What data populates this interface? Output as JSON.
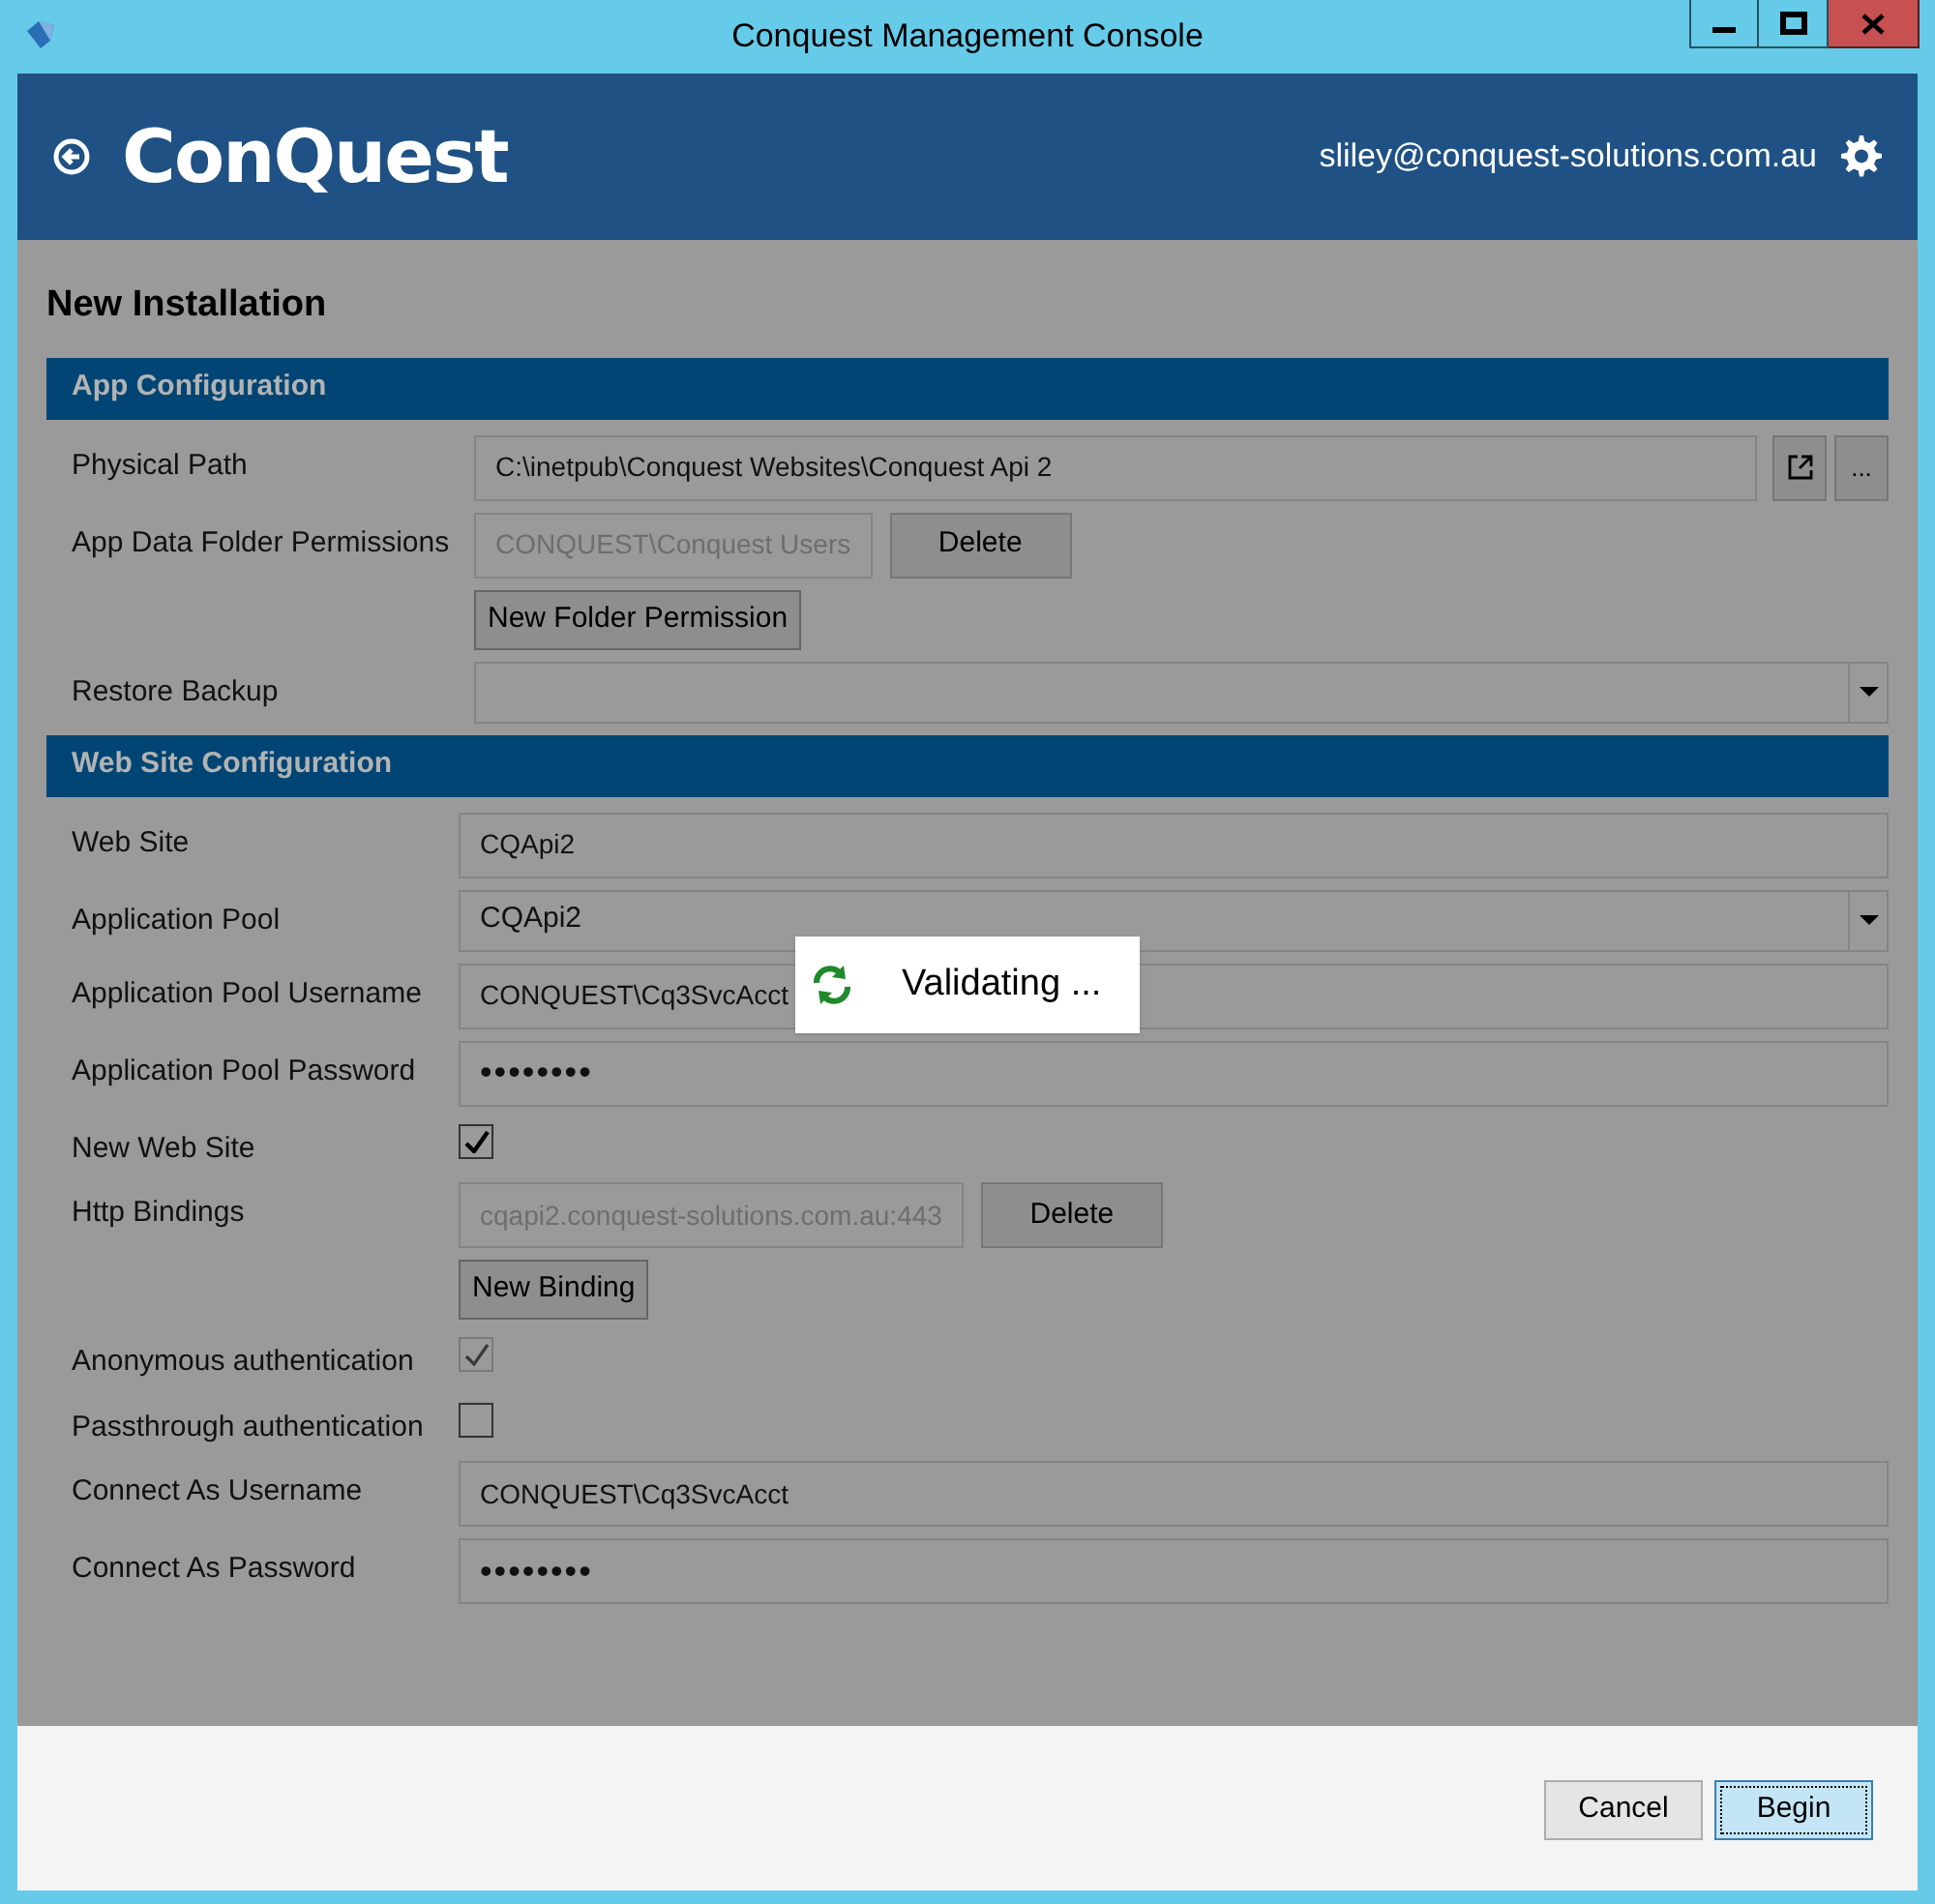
{
  "window": {
    "title": "Conquest Management Console"
  },
  "header": {
    "logo": "ConQuest",
    "user": "sliley@conquest-solutions.com.au"
  },
  "page_title": "New Installation",
  "sections": [
    {
      "title": "App Configuration",
      "rows": [
        {
          "kind": "field",
          "label": "Physical Path",
          "value": "C:\\inetpub\\Conquest Websites\\Conquest Api 2",
          "open_button": true,
          "browse_button": "..."
        },
        {
          "kind": "entry",
          "label": "App Data Folder Permissions",
          "value": "CONQUEST\\Conquest Users",
          "button": "Delete"
        },
        {
          "kind": "button",
          "button": "New Folder Permission"
        },
        {
          "kind": "select",
          "label": "Restore Backup"
        }
      ]
    },
    {
      "title": "Web Site Configuration",
      "rows": [
        {
          "kind": "field",
          "label": "Web Site",
          "value": "CQApi2"
        },
        {
          "kind": "select",
          "label": "Application Pool",
          "value": "CQApi2"
        },
        {
          "kind": "field",
          "label": "Application Pool Username",
          "value": "CONQUEST\\Cq3SvcAcct"
        },
        {
          "kind": "password",
          "label": "Application Pool Password",
          "value": "••••••••"
        },
        {
          "kind": "checkbox",
          "label": "New Web Site",
          "checked": true,
          "disabled": false
        },
        {
          "kind": "entry",
          "label": "Http Bindings",
          "value": "cqapi2.conquest-solutions.com.au:443",
          "button": "Delete"
        },
        {
          "kind": "button",
          "button": "New Binding"
        },
        {
          "kind": "checkbox",
          "label": "Anonymous authentication",
          "checked": true,
          "disabled": true
        },
        {
          "kind": "checkbox",
          "label": "Passthrough authentication",
          "checked": false,
          "disabled": false
        },
        {
          "kind": "field",
          "label": "Connect As Username",
          "value": "CONQUEST\\Cq3SvcAcct"
        },
        {
          "kind": "password",
          "label": "Connect As Password",
          "value": "••••••••"
        }
      ]
    }
  ],
  "overlay": {
    "text": "Validating ..."
  },
  "footer": {
    "buttons": [
      {
        "label": "Cancel",
        "focused": false
      },
      {
        "label": "Begin",
        "focused": true
      }
    ]
  }
}
